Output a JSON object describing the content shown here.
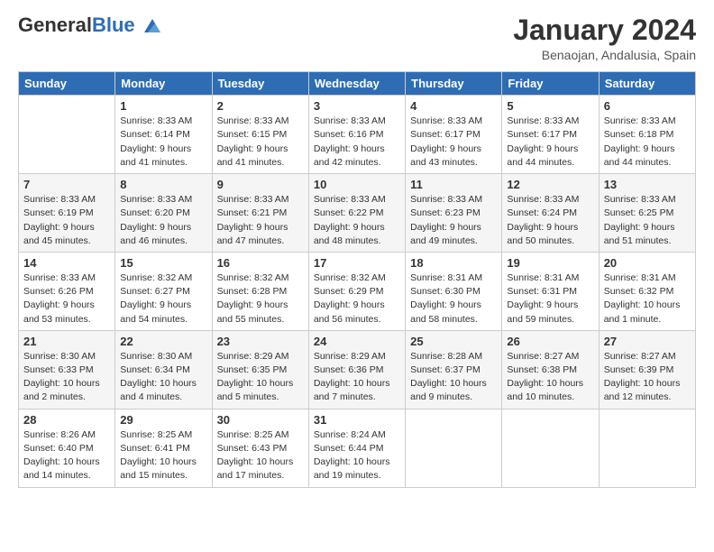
{
  "header": {
    "logo_general": "General",
    "logo_blue": "Blue",
    "month_title": "January 2024",
    "location": "Benaojan, Andalusia, Spain"
  },
  "weekdays": [
    "Sunday",
    "Monday",
    "Tuesday",
    "Wednesday",
    "Thursday",
    "Friday",
    "Saturday"
  ],
  "weeks": [
    [
      {
        "day": "",
        "info": ""
      },
      {
        "day": "1",
        "info": "Sunrise: 8:33 AM\nSunset: 6:14 PM\nDaylight: 9 hours\nand 41 minutes."
      },
      {
        "day": "2",
        "info": "Sunrise: 8:33 AM\nSunset: 6:15 PM\nDaylight: 9 hours\nand 41 minutes."
      },
      {
        "day": "3",
        "info": "Sunrise: 8:33 AM\nSunset: 6:16 PM\nDaylight: 9 hours\nand 42 minutes."
      },
      {
        "day": "4",
        "info": "Sunrise: 8:33 AM\nSunset: 6:17 PM\nDaylight: 9 hours\nand 43 minutes."
      },
      {
        "day": "5",
        "info": "Sunrise: 8:33 AM\nSunset: 6:17 PM\nDaylight: 9 hours\nand 44 minutes."
      },
      {
        "day": "6",
        "info": "Sunrise: 8:33 AM\nSunset: 6:18 PM\nDaylight: 9 hours\nand 44 minutes."
      }
    ],
    [
      {
        "day": "7",
        "info": "Sunrise: 8:33 AM\nSunset: 6:19 PM\nDaylight: 9 hours\nand 45 minutes."
      },
      {
        "day": "8",
        "info": "Sunrise: 8:33 AM\nSunset: 6:20 PM\nDaylight: 9 hours\nand 46 minutes."
      },
      {
        "day": "9",
        "info": "Sunrise: 8:33 AM\nSunset: 6:21 PM\nDaylight: 9 hours\nand 47 minutes."
      },
      {
        "day": "10",
        "info": "Sunrise: 8:33 AM\nSunset: 6:22 PM\nDaylight: 9 hours\nand 48 minutes."
      },
      {
        "day": "11",
        "info": "Sunrise: 8:33 AM\nSunset: 6:23 PM\nDaylight: 9 hours\nand 49 minutes."
      },
      {
        "day": "12",
        "info": "Sunrise: 8:33 AM\nSunset: 6:24 PM\nDaylight: 9 hours\nand 50 minutes."
      },
      {
        "day": "13",
        "info": "Sunrise: 8:33 AM\nSunset: 6:25 PM\nDaylight: 9 hours\nand 51 minutes."
      }
    ],
    [
      {
        "day": "14",
        "info": "Sunrise: 8:33 AM\nSunset: 6:26 PM\nDaylight: 9 hours\nand 53 minutes."
      },
      {
        "day": "15",
        "info": "Sunrise: 8:32 AM\nSunset: 6:27 PM\nDaylight: 9 hours\nand 54 minutes."
      },
      {
        "day": "16",
        "info": "Sunrise: 8:32 AM\nSunset: 6:28 PM\nDaylight: 9 hours\nand 55 minutes."
      },
      {
        "day": "17",
        "info": "Sunrise: 8:32 AM\nSunset: 6:29 PM\nDaylight: 9 hours\nand 56 minutes."
      },
      {
        "day": "18",
        "info": "Sunrise: 8:31 AM\nSunset: 6:30 PM\nDaylight: 9 hours\nand 58 minutes."
      },
      {
        "day": "19",
        "info": "Sunrise: 8:31 AM\nSunset: 6:31 PM\nDaylight: 9 hours\nand 59 minutes."
      },
      {
        "day": "20",
        "info": "Sunrise: 8:31 AM\nSunset: 6:32 PM\nDaylight: 10 hours\nand 1 minute."
      }
    ],
    [
      {
        "day": "21",
        "info": "Sunrise: 8:30 AM\nSunset: 6:33 PM\nDaylight: 10 hours\nand 2 minutes."
      },
      {
        "day": "22",
        "info": "Sunrise: 8:30 AM\nSunset: 6:34 PM\nDaylight: 10 hours\nand 4 minutes."
      },
      {
        "day": "23",
        "info": "Sunrise: 8:29 AM\nSunset: 6:35 PM\nDaylight: 10 hours\nand 5 minutes."
      },
      {
        "day": "24",
        "info": "Sunrise: 8:29 AM\nSunset: 6:36 PM\nDaylight: 10 hours\nand 7 minutes."
      },
      {
        "day": "25",
        "info": "Sunrise: 8:28 AM\nSunset: 6:37 PM\nDaylight: 10 hours\nand 9 minutes."
      },
      {
        "day": "26",
        "info": "Sunrise: 8:27 AM\nSunset: 6:38 PM\nDaylight: 10 hours\nand 10 minutes."
      },
      {
        "day": "27",
        "info": "Sunrise: 8:27 AM\nSunset: 6:39 PM\nDaylight: 10 hours\nand 12 minutes."
      }
    ],
    [
      {
        "day": "28",
        "info": "Sunrise: 8:26 AM\nSunset: 6:40 PM\nDaylight: 10 hours\nand 14 minutes."
      },
      {
        "day": "29",
        "info": "Sunrise: 8:25 AM\nSunset: 6:41 PM\nDaylight: 10 hours\nand 15 minutes."
      },
      {
        "day": "30",
        "info": "Sunrise: 8:25 AM\nSunset: 6:43 PM\nDaylight: 10 hours\nand 17 minutes."
      },
      {
        "day": "31",
        "info": "Sunrise: 8:24 AM\nSunset: 6:44 PM\nDaylight: 10 hours\nand 19 minutes."
      },
      {
        "day": "",
        "info": ""
      },
      {
        "day": "",
        "info": ""
      },
      {
        "day": "",
        "info": ""
      }
    ]
  ]
}
